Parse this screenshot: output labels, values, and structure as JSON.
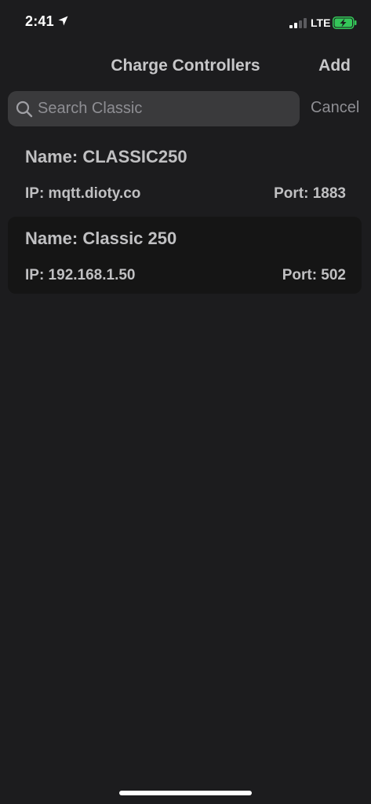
{
  "status_bar": {
    "time": "2:41",
    "network": "LTE",
    "battery_color": "#34c759"
  },
  "nav": {
    "title": "Charge Controllers",
    "add_label": "Add"
  },
  "search": {
    "placeholder": "Search Classic",
    "value": "",
    "cancel_label": "Cancel"
  },
  "controllers": [
    {
      "name": "Name: CLASSIC250",
      "ip": "IP: mqtt.dioty.co",
      "port": "Port: 1883"
    },
    {
      "name": "Name: Classic 250",
      "ip": "IP: 192.168.1.50",
      "port": "Port: 502"
    }
  ],
  "icons": {
    "location": "location-arrow-icon",
    "signal": "cellular-signal-icon",
    "battery": "battery-charging-icon",
    "search": "search-icon"
  }
}
